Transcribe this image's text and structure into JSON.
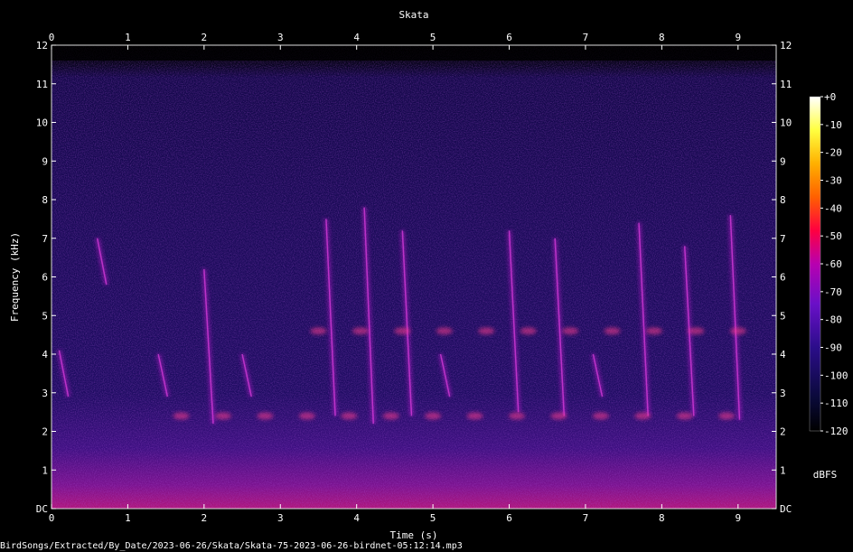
{
  "chart_data": {
    "type": "heatmap",
    "title": "Skata",
    "xlabel": "Time (s)",
    "ylabel": "Frequency (kHz)",
    "xlim": [
      0,
      9.5
    ],
    "ylim": [
      0,
      12
    ],
    "x_ticks": [
      "0",
      "1",
      "2",
      "3",
      "4",
      "5",
      "6",
      "7",
      "8",
      "9"
    ],
    "y_ticks": [
      "DC",
      "1",
      "2",
      "3",
      "4",
      "5",
      "6",
      "7",
      "8",
      "9",
      "10",
      "11",
      "12"
    ],
    "colorbar": {
      "label": "dBFS",
      "range": [
        -120,
        0
      ],
      "ticks": [
        "+0",
        "-10",
        "-20",
        "-30",
        "-40",
        "-50",
        "-60",
        "-70",
        "-80",
        "-90",
        "-100",
        "-110",
        "-120"
      ],
      "colors": [
        "#000000",
        "#0a0a3a",
        "#2b0d8a",
        "#6a10c8",
        "#b800b0",
        "#ff0040",
        "#ff6000",
        "#ffb000",
        "#ffff40",
        "#ffffff"
      ]
    },
    "noise_floor_kHz": 11.6,
    "calls": [
      {
        "t": 0.1,
        "f_start": 4.1,
        "f_end": 2.9
      },
      {
        "t": 0.6,
        "f_start": 7.0,
        "f_end": 5.8
      },
      {
        "t": 1.4,
        "f_start": 4.0,
        "f_end": 2.9
      },
      {
        "t": 2.0,
        "f_start": 6.2,
        "f_end": 2.2
      },
      {
        "t": 2.5,
        "f_start": 4.0,
        "f_end": 2.9
      },
      {
        "t": 3.6,
        "f_start": 7.5,
        "f_end": 2.4
      },
      {
        "t": 4.1,
        "f_start": 7.8,
        "f_end": 2.2
      },
      {
        "t": 4.6,
        "f_start": 7.2,
        "f_end": 2.4
      },
      {
        "t": 5.1,
        "f_start": 4.0,
        "f_end": 2.9
      },
      {
        "t": 6.0,
        "f_start": 7.2,
        "f_end": 2.5
      },
      {
        "t": 6.6,
        "f_start": 7.0,
        "f_end": 2.4
      },
      {
        "t": 7.1,
        "f_start": 4.0,
        "f_end": 2.9
      },
      {
        "t": 7.7,
        "f_start": 7.4,
        "f_end": 2.4
      },
      {
        "t": 8.3,
        "f_start": 6.8,
        "f_end": 2.4
      },
      {
        "t": 8.9,
        "f_start": 7.6,
        "f_end": 2.3
      }
    ],
    "bright_bands": [
      {
        "f": 2.4,
        "t": [
          1.7,
          9.2
        ]
      },
      {
        "f": 4.6,
        "t": [
          3.5,
          9.2
        ]
      }
    ]
  },
  "caption": "BirdSongs/Extracted/By_Date/2023-06-26/Skata/Skata-75-2023-06-26-birdnet-05:12:14.mp3"
}
